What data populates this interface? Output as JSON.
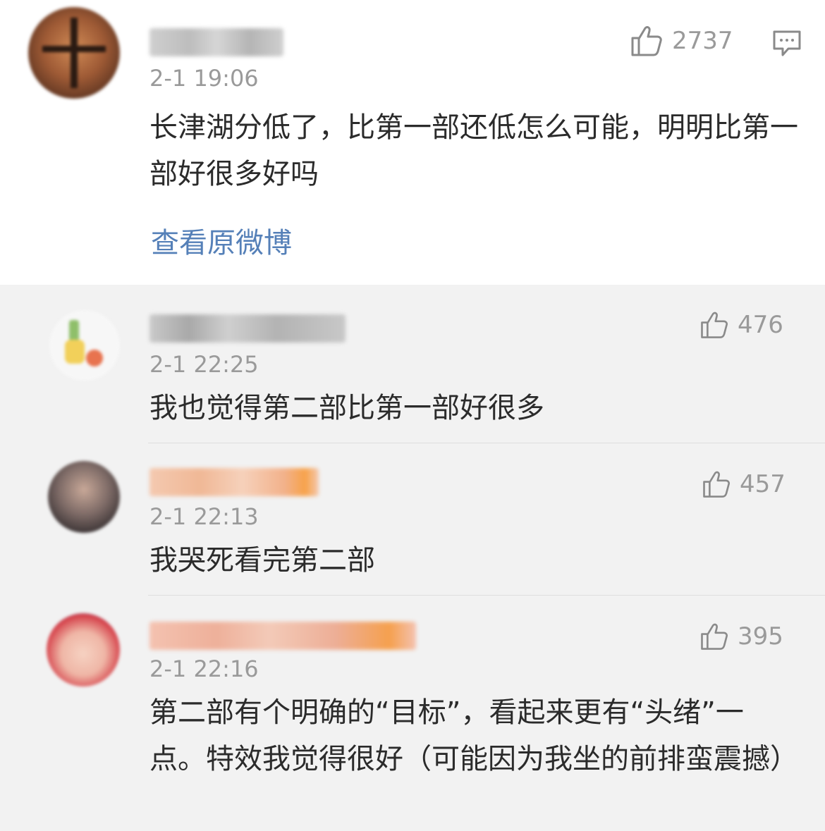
{
  "main_comment": {
    "time": "2-1 19:06",
    "text": "长津湖分低了，比第一部还低怎么可能，明明比第一部好很多好吗",
    "like_count": "2737",
    "view_original_link": "查看原微博"
  },
  "replies": [
    {
      "time": "2-1 22:25",
      "text": "我也觉得第二部比第一部好很多",
      "like_count": "476"
    },
    {
      "time": "2-1 22:13",
      "text": "我哭死看完第二部",
      "like_count": "457"
    },
    {
      "time": "2-1 22:16",
      "text": "第二部有个明确的“目标”，看起来更有“头绪”一点。特效我觉得很好（可能因为我坐的前排蛮震撼）",
      "like_count": "395"
    }
  ],
  "icons": {
    "like": "thumbs-up-icon",
    "reply": "comment-icon"
  },
  "colors": {
    "link": "#5580b8",
    "secondary_text": "#9a9a9a",
    "reply_background": "#f2f2f2"
  }
}
